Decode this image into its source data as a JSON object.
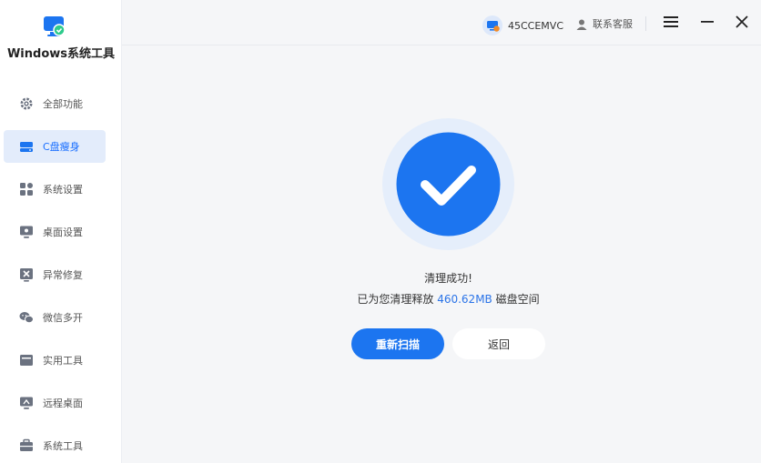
{
  "app": {
    "title": "Windows系统工具",
    "accent": "#1c75f0"
  },
  "sidebar": {
    "items": [
      {
        "label": "全部功能",
        "icon": "gear-icon",
        "active": false
      },
      {
        "label": "C盘瘦身",
        "icon": "drive-icon",
        "active": true
      },
      {
        "label": "系统设置",
        "icon": "apps-grid-icon",
        "active": false
      },
      {
        "label": "桌面设置",
        "icon": "monitor-icon",
        "active": false
      },
      {
        "label": "异常修复",
        "icon": "repair-icon",
        "active": false
      },
      {
        "label": "微信多开",
        "icon": "wechat-icon",
        "active": false
      },
      {
        "label": "实用工具",
        "icon": "toolbox-icon",
        "active": false
      },
      {
        "label": "远程桌面",
        "icon": "remote-desktop-icon",
        "active": false
      },
      {
        "label": "系统工具",
        "icon": "briefcase-icon",
        "active": false
      }
    ]
  },
  "header": {
    "username": "45CCEMVC",
    "support_label": "联系客服"
  },
  "result": {
    "title": "清理成功!",
    "detail_prefix": "已为您清理释放 ",
    "freed_amount": "460.62MB",
    "detail_suffix": " 磁盘空间",
    "rescan_label": "重新扫描",
    "back_label": "返回"
  }
}
